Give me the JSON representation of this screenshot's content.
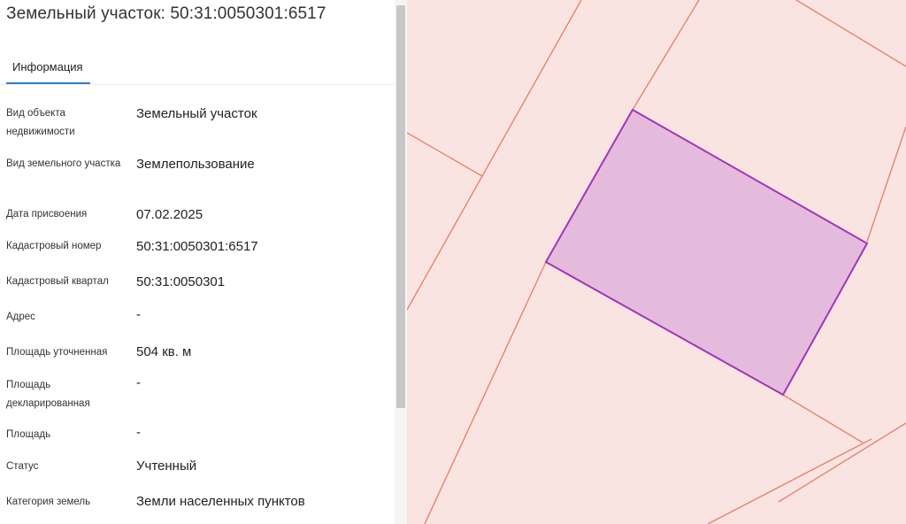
{
  "panel": {
    "title": "Земельный участок: 50:31:0050301:6517",
    "tabs": [
      {
        "label": "Информация"
      }
    ],
    "rows": [
      {
        "label": "Вид объекта недвижимости",
        "value": "Земельный участок"
      },
      {
        "label": "Вид земельного участка",
        "value": "Землепользование"
      },
      {
        "label": "Дата присвоения",
        "value": "07.02.2025"
      },
      {
        "label": "Кадастровый номер",
        "value": "50:31:0050301:6517"
      },
      {
        "label": "Кадастровый квартал",
        "value": "50:31:0050301"
      },
      {
        "label": "Адрес",
        "value": "-"
      },
      {
        "label": "Площадь уточненная",
        "value": "504 кв. м"
      },
      {
        "label": "Площадь декларированная",
        "value": "-"
      },
      {
        "label": "Площадь",
        "value": "-"
      },
      {
        "label": "Статус",
        "value": "Учтенный"
      },
      {
        "label": "Категория земель",
        "value": "Земли населенных пунктов"
      }
    ]
  },
  "map": {
    "background_color": "#f9e4e1",
    "boundary_color": "#e8836e",
    "selected_parcel_fill": "#e4bbdc",
    "selected_parcel_stroke": "#a334b8"
  }
}
